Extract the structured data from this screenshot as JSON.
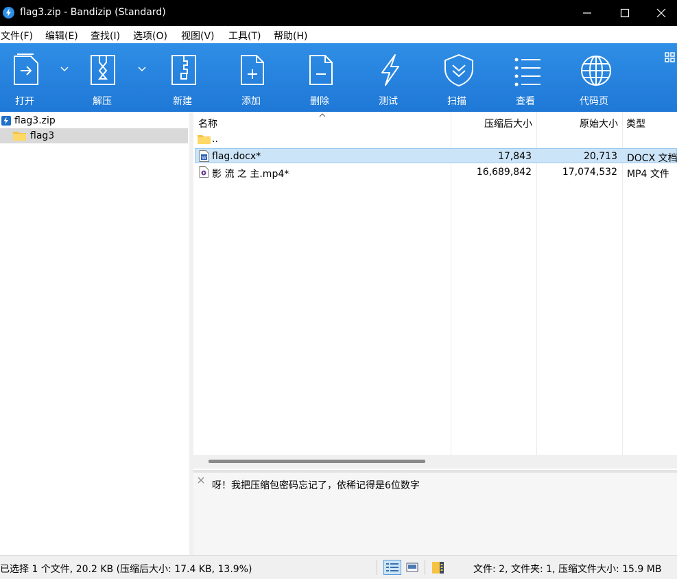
{
  "window": {
    "title": "flag3.zip - Bandizip (Standard)"
  },
  "menu": [
    "文件(F)",
    "编辑(E)",
    "查找(I)",
    "选项(O)",
    "视图(V)",
    "工具(T)",
    "帮助(H)"
  ],
  "toolbar": {
    "open": "打开",
    "extract": "解压",
    "new": "新建",
    "add": "添加",
    "delete": "删除",
    "test": "测试",
    "scan": "扫描",
    "view": "查看",
    "codepage": "代码页"
  },
  "tree": {
    "root": "flag3.zip",
    "folder": "flag3"
  },
  "columns": {
    "name": "名称",
    "packed": "压缩后大小",
    "original": "原始大小",
    "type": "类型"
  },
  "files": [
    {
      "name": "..",
      "packed": "",
      "original": "",
      "type": ""
    },
    {
      "name": "flag.docx*",
      "packed": "17,843",
      "original": "20,713",
      "type": "DOCX 文档"
    },
    {
      "name": "影 流 之 主.mp4*",
      "packed": "16,689,842",
      "original": "17,074,532",
      "type": "MP4 文件"
    }
  ],
  "comment": "呀！我把压缩包密码忘记了，依稀记得是6位数字",
  "status": {
    "left": "已选择 1 个文件, 20.2 KB (压缩后大小: 17.4 KB, 13.9%)",
    "right": "文件: 2, 文件夹: 1, 压缩文件大小: 15.9 MB"
  },
  "colors": {
    "toolbar_blue": "#2a86e0",
    "selection": "#cce4f7",
    "titlebar": "#000000"
  }
}
